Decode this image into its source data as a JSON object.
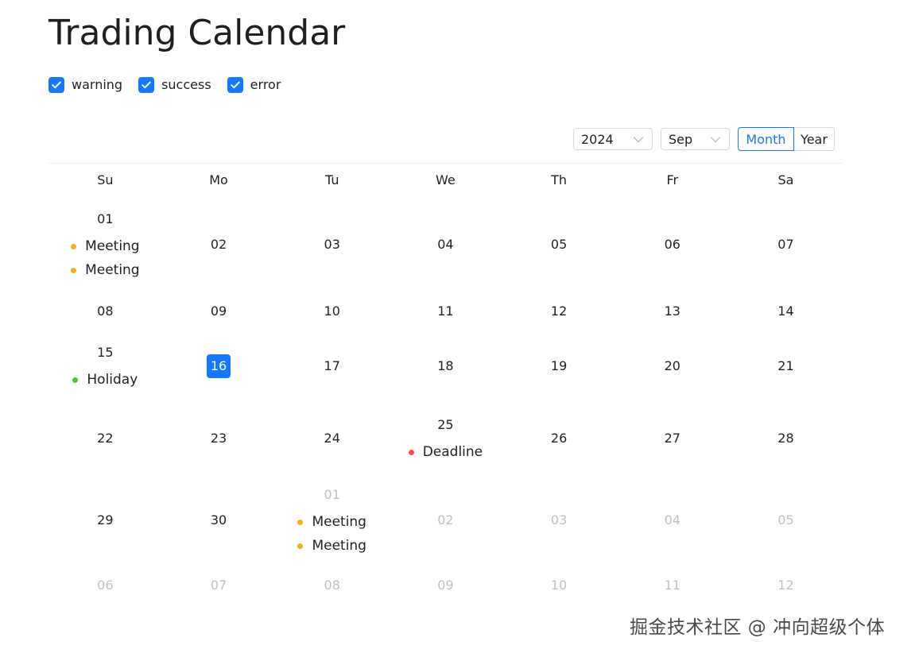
{
  "page": {
    "title": "Trading Calendar"
  },
  "filters": [
    {
      "label": "warning",
      "checked": true
    },
    {
      "label": "success",
      "checked": true
    },
    {
      "label": "error",
      "checked": true
    }
  ],
  "header": {
    "year_value": "2024",
    "month_value": "Sep",
    "mode_month": "Month",
    "mode_year": "Year",
    "selected_mode": "Month"
  },
  "calendar": {
    "weekdays": [
      "Su",
      "Mo",
      "Tu",
      "We",
      "Th",
      "Fr",
      "Sa"
    ],
    "today": "16",
    "weeks": [
      [
        {
          "day": "01",
          "out": false,
          "events": [
            {
              "type": "warning",
              "label": "Meeting"
            },
            {
              "type": "warning",
              "label": "Meeting"
            }
          ]
        },
        {
          "day": "02",
          "out": false,
          "events": []
        },
        {
          "day": "03",
          "out": false,
          "events": []
        },
        {
          "day": "04",
          "out": false,
          "events": []
        },
        {
          "day": "05",
          "out": false,
          "events": []
        },
        {
          "day": "06",
          "out": false,
          "events": []
        },
        {
          "day": "07",
          "out": false,
          "events": []
        }
      ],
      [
        {
          "day": "08",
          "out": false,
          "events": []
        },
        {
          "day": "09",
          "out": false,
          "events": []
        },
        {
          "day": "10",
          "out": false,
          "events": []
        },
        {
          "day": "11",
          "out": false,
          "events": []
        },
        {
          "day": "12",
          "out": false,
          "events": []
        },
        {
          "day": "13",
          "out": false,
          "events": []
        },
        {
          "day": "14",
          "out": false,
          "events": []
        }
      ],
      [
        {
          "day": "15",
          "out": false,
          "events": [
            {
              "type": "success",
              "label": "Holiday"
            }
          ]
        },
        {
          "day": "16",
          "out": false,
          "today": true,
          "events": []
        },
        {
          "day": "17",
          "out": false,
          "events": []
        },
        {
          "day": "18",
          "out": false,
          "events": []
        },
        {
          "day": "19",
          "out": false,
          "events": []
        },
        {
          "day": "20",
          "out": false,
          "events": []
        },
        {
          "day": "21",
          "out": false,
          "events": []
        }
      ],
      [
        {
          "day": "22",
          "out": false,
          "events": []
        },
        {
          "day": "23",
          "out": false,
          "events": []
        },
        {
          "day": "24",
          "out": false,
          "events": []
        },
        {
          "day": "25",
          "out": false,
          "events": [
            {
              "type": "error",
              "label": "Deadline"
            }
          ]
        },
        {
          "day": "26",
          "out": false,
          "events": []
        },
        {
          "day": "27",
          "out": false,
          "events": []
        },
        {
          "day": "28",
          "out": false,
          "events": []
        }
      ],
      [
        {
          "day": "29",
          "out": false,
          "events": []
        },
        {
          "day": "30",
          "out": false,
          "events": []
        },
        {
          "day": "01",
          "out": true,
          "events": [
            {
              "type": "warning",
              "label": "Meeting"
            },
            {
              "type": "warning",
              "label": "Meeting"
            }
          ]
        },
        {
          "day": "02",
          "out": true,
          "events": []
        },
        {
          "day": "03",
          "out": true,
          "events": []
        },
        {
          "day": "04",
          "out": true,
          "events": []
        },
        {
          "day": "05",
          "out": true,
          "events": []
        }
      ],
      [
        {
          "day": "06",
          "out": true,
          "events": []
        },
        {
          "day": "07",
          "out": true,
          "events": []
        },
        {
          "day": "08",
          "out": true,
          "events": []
        },
        {
          "day": "09",
          "out": true,
          "events": []
        },
        {
          "day": "10",
          "out": true,
          "events": []
        },
        {
          "day": "11",
          "out": true,
          "events": []
        },
        {
          "day": "12",
          "out": true,
          "events": []
        }
      ]
    ]
  },
  "status_colors": {
    "warning": "#faad14",
    "success": "#52c41a",
    "error": "#ff4d4f",
    "primary": "#1677ff"
  },
  "watermark": {
    "text": "掘金技术社区 @ 冲向超级个体"
  }
}
